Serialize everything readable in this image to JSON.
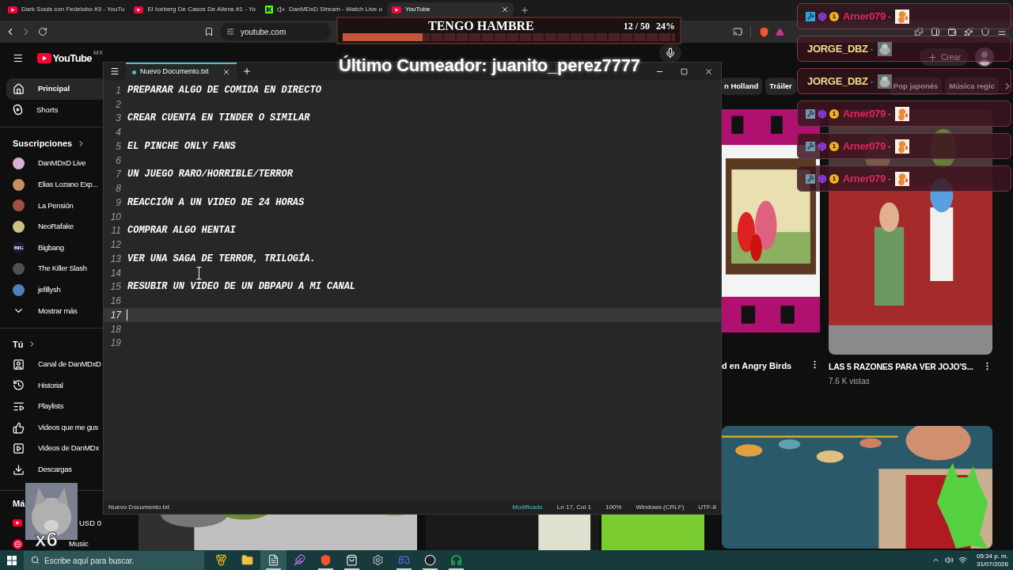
{
  "browser": {
    "tabs": [
      {
        "title": "Dark Souls con Fedelobo #3 - YouTu",
        "kind": "youtube",
        "muted": false,
        "selected": false
      },
      {
        "title": "El Iceberg De Casos De Aliens #1 - Yo",
        "kind": "youtube",
        "muted": false,
        "selected": false
      },
      {
        "title": "DanMDxD Stream - Watch Live o",
        "kind": "kick",
        "muted": true,
        "selected": false
      },
      {
        "title": "YouTube",
        "kind": "youtube",
        "muted": false,
        "selected": true
      }
    ],
    "address": "youtube.com"
  },
  "youtube": {
    "logo": "YouTube",
    "region": "MX",
    "create_button": "Crear",
    "sidebar": {
      "main": [
        {
          "label": "Principal",
          "kind": "home",
          "selected": true
        },
        {
          "label": "Shorts",
          "kind": "shorts",
          "selected": false
        }
      ],
      "subscriptions_heading": "Suscripciones",
      "subscriptions": [
        {
          "label": "DanMDxD Live",
          "color": "#d8b0d8"
        },
        {
          "label": "Elias Lozano Exp...",
          "color": "#c89060"
        },
        {
          "label": "La Pensión",
          "color": "#a05040"
        },
        {
          "label": "NeoRafake",
          "color": "#d0c080"
        },
        {
          "label": "Bigbang",
          "color": "#1a1a3a",
          "avatar_text": "BIG"
        },
        {
          "label": "The Killer Slash",
          "color": "#505050"
        },
        {
          "label": "jefillysh",
          "color": "#5080c0"
        }
      ],
      "show_more": "Mostrar más",
      "you_heading": "Tú",
      "you_items": [
        {
          "label": "Canal de DanMDxD",
          "kind": "channel"
        },
        {
          "label": "Historial",
          "kind": "history"
        },
        {
          "label": "Playlists",
          "kind": "playlists"
        },
        {
          "label": "Videos que me gus",
          "kind": "liked"
        },
        {
          "label": "Videos de DanMDx",
          "kind": "videos"
        },
        {
          "label": "Descargas",
          "kind": "downloads"
        }
      ],
      "more_heading": "Má",
      "more_items": [
        {
          "label": "USD 0",
          "kind": "premium"
        },
        {
          "label": "Music",
          "kind": "music"
        }
      ]
    },
    "chips": [
      {
        "label": "n Holland",
        "selected": false
      },
      {
        "label": "Tráiler",
        "selected": false
      },
      {
        "label": "Pop japonés",
        "selected": false
      },
      {
        "label": "Música regic",
        "selected": false
      }
    ],
    "videos": [
      {
        "title": "d en Angry Birds"
      },
      {
        "title": "LAS 5 RAZONES PARA VER JOJO'S...",
        "views": "7.6 K vistas"
      }
    ]
  },
  "notepad": {
    "tab": "Nuevo Documento.txt",
    "modified": true,
    "lines": [
      {
        "number": "1",
        "text": "PREPARAR ALGO DE COMIDA EN DIRECTO",
        "current": false
      },
      {
        "number": "2",
        "current": false
      },
      {
        "number": "3",
        "text": "CREAR CUENTA EN TINDER O SIMILAR",
        "current": false
      },
      {
        "number": "4",
        "current": false
      },
      {
        "number": "5",
        "text": "EL PINCHE ONLY FANS",
        "current": false
      },
      {
        "number": "6",
        "current": false
      },
      {
        "number": "7",
        "text": "UN JUEGO RARO/HORRIBLE/TERROR",
        "current": false
      },
      {
        "number": "8",
        "current": false
      },
      {
        "number": "9",
        "text": "REACCIÓN A UN VIDEO DE 24 HORAS",
        "current": false
      },
      {
        "number": "10",
        "current": false
      },
      {
        "number": "11",
        "text": "COMPRAR ALGO HENTAI",
        "current": false
      },
      {
        "number": "12",
        "current": false
      },
      {
        "number": "13",
        "text": "VER UNA SAGA DE TERROR, TRILOGÍA.",
        "current": false
      },
      {
        "number": "14",
        "current": false
      },
      {
        "number": "15",
        "text": "RESUBIR UN VIDEO DE UN DBPAPU A MI CANAL",
        "current": false
      },
      {
        "number": "16",
        "current": false
      },
      {
        "number": "17",
        "current": true
      },
      {
        "number": "18",
        "current": false
      },
      {
        "number": "19",
        "current": false
      }
    ],
    "status": {
      "file": "Nuevo Documento.txt",
      "state": "Modificado",
      "position": "Ln 17, Col 1",
      "zoom": "100%",
      "line_ending": "Windows (CRLF)",
      "encoding": "UTF-8"
    }
  },
  "overlay": {
    "goal": {
      "title": "TENGO HAMBRE",
      "count": "12 / 50",
      "percent": "24%",
      "level": 0.24
    },
    "last_cumeador": "Último Cumeador: juanito_perez7777",
    "chat": [
      {
        "name": "Arner079",
        "color": "#e0245e",
        "badges": true,
        "badge_level": "1",
        "dot": "·",
        "faded": false
      },
      {
        "name": "JORGE_DBZ",
        "color": "#eedd88",
        "badges": false,
        "dot": "·",
        "faded": false
      },
      {
        "name": "JORGE_DBZ",
        "color": "#eedd88",
        "badges": false,
        "dot": "·",
        "faded": false
      },
      {
        "name": "Arner079",
        "color": "#e0245e",
        "badges": true,
        "badge_level": "1",
        "dot": "·",
        "faded": true
      },
      {
        "name": "Arner079",
        "color": "#e0245e",
        "badges": true,
        "badge_level": "1",
        "dot": "·",
        "faded": true
      },
      {
        "name": "Arner079",
        "color": "#e0245e",
        "badges": true,
        "badge_level": "1",
        "dot": "·",
        "faded": true
      }
    ],
    "multiplier": "x6"
  },
  "taskbar": {
    "search_placeholder": "Escribe aquí para buscar.",
    "apps": [
      {
        "kind": "medal",
        "selected": false,
        "running": false
      },
      {
        "kind": "folder",
        "selected": false,
        "running": false
      },
      {
        "kind": "notepad",
        "selected": true,
        "running": true
      },
      {
        "kind": "feather",
        "selected": false,
        "running": false
      },
      {
        "kind": "brave",
        "selected": false,
        "running": true
      },
      {
        "kind": "store",
        "selected": false,
        "running": true
      },
      {
        "kind": "gear",
        "selected": false,
        "running": false
      },
      {
        "kind": "discord",
        "selected": false,
        "running": true
      },
      {
        "kind": "obs",
        "selected": false,
        "running": true
      },
      {
        "kind": "spotify",
        "selected": false,
        "running": true
      }
    ],
    "time": "05:34 p. m.",
    "date": "31/07/2026"
  }
}
